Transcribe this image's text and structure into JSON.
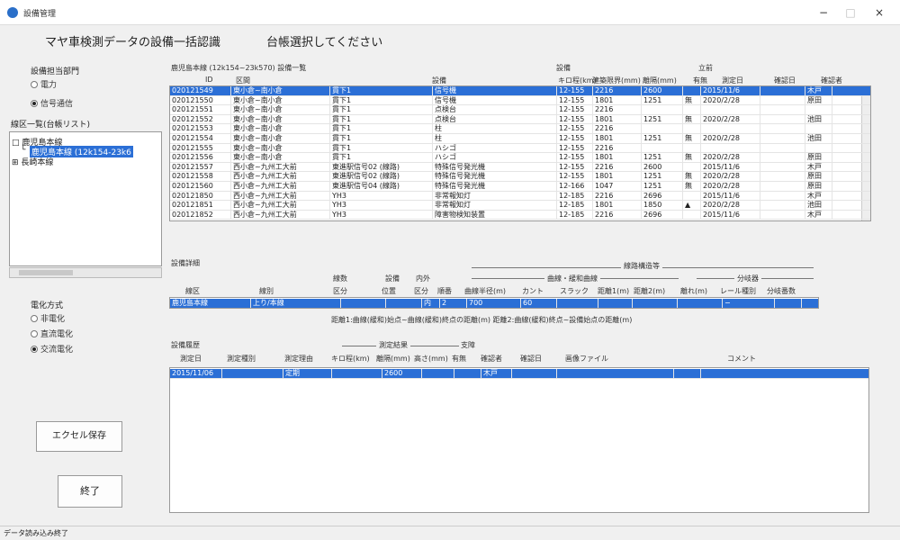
{
  "window": {
    "title": "設備管理",
    "minimize": "−",
    "maximize": "□",
    "close": "×"
  },
  "header": {
    "title": "マヤ車検測データの設備一括認識",
    "subtitle": "台帳選択してください"
  },
  "dept": {
    "label": "設備担当部門",
    "options": [
      {
        "label": "電力",
        "selected": false
      },
      {
        "label": "信号通信",
        "selected": true
      }
    ]
  },
  "line_list": {
    "label": "線区一覧(台帳リスト)",
    "items": [
      {
        "prefix": "□",
        "label": "鹿児島本線",
        "selected": false
      },
      {
        "prefix": "└",
        "label": "鹿児島本線 (12k154-23k6",
        "selected": true
      },
      {
        "prefix": "⊞",
        "label": "長崎本線",
        "selected": false
      }
    ]
  },
  "elec": {
    "label": "電化方式",
    "options": [
      {
        "label": "非電化",
        "selected": false
      },
      {
        "label": "直流電化",
        "selected": false
      },
      {
        "label": "交流電化",
        "selected": true
      }
    ]
  },
  "buttons": {
    "excel": "エクセル保存",
    "exit": "終了"
  },
  "main_grid": {
    "title": "鹿児島本線 (12k154~23k570) 設備一覧",
    "group_labels": {
      "setsubi": "設備",
      "tachi": "立前"
    },
    "columns": [
      "ID",
      "区間",
      "",
      "設備",
      "キロ程(km)",
      "建築限界(mm)",
      "離隔(mm)",
      "有無",
      "測定日",
      "確認日",
      "確認者"
    ],
    "rows": [
      [
        "020121549",
        "東小倉~南小倉",
        "貫下1",
        "信号機",
        "12-155",
        "2216",
        "2600",
        "",
        "2015/11/6",
        "",
        "木戸"
      ],
      [
        "020121550",
        "東小倉~南小倉",
        "貫下1",
        "信号機",
        "12-155",
        "1801",
        "1251",
        "無",
        "2020/2/28",
        "",
        "原田"
      ],
      [
        "020121551",
        "東小倉~南小倉",
        "貫下1",
        "点検台",
        "12-155",
        "2216",
        "",
        "",
        "",
        "",
        ""
      ],
      [
        "020121552",
        "東小倉~南小倉",
        "貫下1",
        "点検台",
        "12-155",
        "1801",
        "1251",
        "無",
        "2020/2/28",
        "",
        "池田"
      ],
      [
        "020121553",
        "東小倉~南小倉",
        "貫下1",
        "柱",
        "12-155",
        "2216",
        "",
        "",
        "",
        "",
        ""
      ],
      [
        "020121554",
        "東小倉~南小倉",
        "貫下1",
        "柱",
        "12-155",
        "1801",
        "1251",
        "無",
        "2020/2/28",
        "",
        "池田"
      ],
      [
        "020121555",
        "東小倉~南小倉",
        "貫下1",
        "ハシゴ",
        "12-155",
        "2216",
        "",
        "",
        "",
        "",
        ""
      ],
      [
        "020121556",
        "東小倉~南小倉",
        "貫下1",
        "ハシゴ",
        "12-155",
        "1801",
        "1251",
        "無",
        "2020/2/28",
        "",
        "原田"
      ],
      [
        "020121557",
        "西小倉~九州工大前",
        "東進駅信号02 (線路)",
        "特殊信号発光機",
        "12-155",
        "2216",
        "2600",
        "",
        "2015/11/6",
        "",
        "木戸"
      ],
      [
        "020121558",
        "西小倉~九州工大前",
        "東進駅信号02 (線路)",
        "特殊信号発光機",
        "12-155",
        "1801",
        "1251",
        "無",
        "2020/2/28",
        "",
        "原田"
      ],
      [
        "020121560",
        "西小倉~九州工大前",
        "東進駅信号04 (線路)",
        "特殊信号発光機",
        "12-166",
        "1047",
        "1251",
        "無",
        "2020/2/28",
        "",
        "原田"
      ],
      [
        "020121850",
        "西小倉~九州工大前",
        "YH3",
        "非常報知灯",
        "12-185",
        "2216",
        "2696",
        "",
        "2015/11/6",
        "",
        "木戸"
      ],
      [
        "020121851",
        "西小倉~九州工大前",
        "YH3",
        "非常報知灯",
        "12-185",
        "1801",
        "1850",
        "▲",
        "2020/2/28",
        "",
        "池田"
      ],
      [
        "020121852",
        "西小倉~九州工大前",
        "YH3",
        "障害物検知装置",
        "12-185",
        "2216",
        "2696",
        "",
        "2015/11/6",
        "",
        "木戸"
      ]
    ]
  },
  "detail": {
    "title": "設備詳細",
    "group_top": "線路構造等",
    "group_curve": "曲線・緩和曲線",
    "group_branch": "分岐器",
    "col_top": [
      "",
      "",
      "線数",
      "設備",
      "内外"
    ],
    "columns": [
      "線区",
      "線別",
      "区分",
      "位置",
      "区分",
      "順番",
      "曲線半径(m)",
      "カント",
      "スラック",
      "距離1(m)",
      "距離2(m)",
      "離れ(m)",
      "レール種別",
      "分岐番数"
    ],
    "row": [
      "鹿児島本線",
      "上り/本線",
      "",
      "",
      "内",
      "2",
      "700",
      "60",
      "",
      "",
      "",
      "",
      "−",
      ""
    ],
    "note": "距離1:曲線(緩和)始点~曲線(緩和)終点の距離(m)  距離2:曲線(緩和)終点~設備始点の距離(m)"
  },
  "history": {
    "title": "設備履歴",
    "group": "測定結果",
    "branch": "支障",
    "columns": [
      "測定日",
      "測定種別",
      "測定理由",
      "キロ程(km)",
      "離隔(mm)",
      "高さ(mm)",
      "有無",
      "確認者",
      "確認日",
      "画像ファイル",
      "コメント"
    ],
    "row": [
      "2015/11/06",
      "",
      "定期",
      "",
      "2600",
      "",
      "",
      "木戸",
      "",
      "",
      ""
    ]
  },
  "status": {
    "text": "データ読み込み終了"
  }
}
